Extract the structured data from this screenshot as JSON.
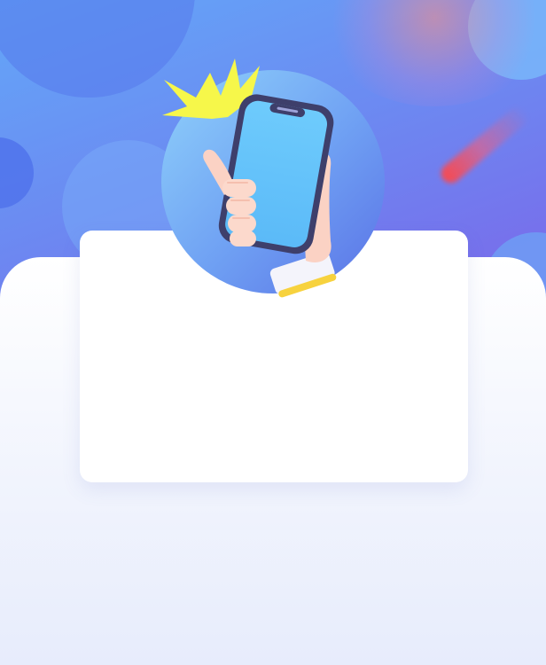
{
  "background": {
    "gradient_start": "#63a7f8",
    "gradient_end": "#7a68ea",
    "lower_panel_color": "#eef2fd",
    "card_color": "#ffffff"
  },
  "illustration": {
    "icon": "hand-holding-phone-icon",
    "burst_color": "#f6f74a",
    "screen_color": "#64c4fb",
    "circle_color": "#6fa0f3"
  },
  "card": {
    "content": ""
  }
}
